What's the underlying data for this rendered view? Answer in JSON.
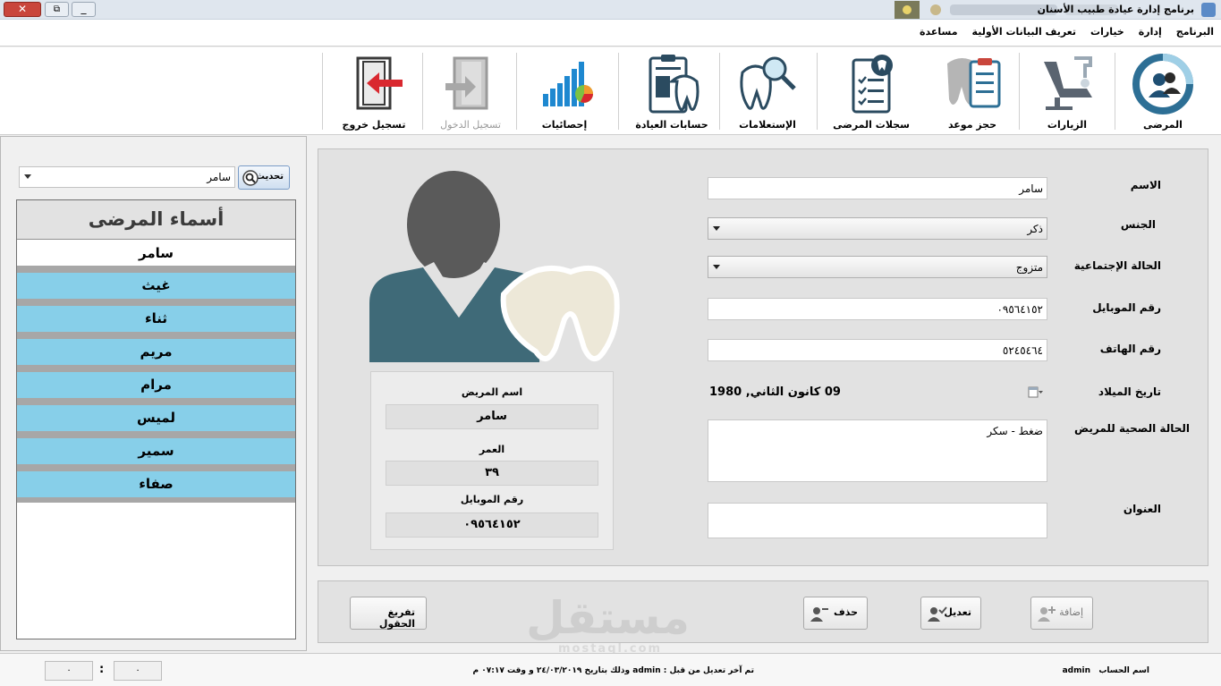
{
  "window": {
    "title": "برنامج إدارة عيادة طبيب الأسنان",
    "close_glyph": "✕",
    "maximize_glyph": "⧉",
    "minimize_glyph": "_"
  },
  "menu": {
    "items": [
      "البرنامج",
      "إدارة",
      "خيارات",
      "تعريف البيانات الأولية",
      "مساعدة"
    ]
  },
  "toolbar": {
    "items": [
      {
        "label": "المرضى",
        "icon": "patients-icon"
      },
      {
        "label": "الزيارات",
        "icon": "dental-chair-icon"
      },
      {
        "label": "حجز موعد",
        "icon": "appointment-icon"
      },
      {
        "label": "سجلات المرضى",
        "icon": "patient-records-icon"
      },
      {
        "label": "الإستعلامات",
        "icon": "tooth-search-icon"
      },
      {
        "label": "حسابات العيادة",
        "icon": "clinic-accounts-icon"
      },
      {
        "label": "إحصائيات",
        "icon": "statistics-icon"
      },
      {
        "label": "تسجيل الدخول",
        "icon": "login-icon",
        "disabled": true
      },
      {
        "label": "تسجيل خروج",
        "icon": "logout-icon"
      }
    ]
  },
  "patients_panel": {
    "search_value": "سامر",
    "refresh_label": "تحديث",
    "list_title": "أسماء المرضى",
    "patients": [
      "سامر",
      "غيث",
      "ثناء",
      "مريم",
      "مرام",
      "لميس",
      "سمير",
      "صفاء"
    ]
  },
  "form": {
    "name_label": "الاسم",
    "name_value": "سامر",
    "gender_label": "الجنس",
    "gender_value": "ذكر",
    "marital_label": "الحالة الإجتماعية",
    "marital_value": "متزوج",
    "mobile_label": "رقم الموبايل",
    "mobile_value": "٠٩٥٦٤١٥٢",
    "phone_label": "رقم الهاتف",
    "phone_value": "٥٢٤٥٤٦٤",
    "birthdate_label": "تاريخ الميلاد",
    "birthdate_value": "09 كانون الثاني, 1980",
    "health_label": "الحالة الصحية للمريض",
    "health_value": "ضغط - سكر",
    "address_label": "العنوان",
    "address_value": ""
  },
  "summary": {
    "patient_name_label": "اسم المريض",
    "patient_name_value": "سامر",
    "age_label": "العمر",
    "age_value": "٣٩",
    "mobile_label": "رقم الموبايل",
    "mobile_value": "٠٩٥٦٤١٥٢"
  },
  "actions": {
    "add_label": "إضافة",
    "edit_label": "تعديل",
    "delete_label": "حذف",
    "clear_label": "تفريغ الحقول"
  },
  "status": {
    "account_label": "اسم الحساب",
    "account_value": "admin",
    "last_edit_text": "تم آخر تعديل من قبل  :  admin  وذلك بتاريخ  ٢٤/٠٣/٢٠١٩  و وقت ٠٧:١٧ م",
    "box_left": "٠",
    "colon": ":",
    "box_right": "٠"
  },
  "watermark": {
    "arabic": "مستقل",
    "latin": "mostaql.com"
  },
  "colors": {
    "list_item_bg": "#87cfe9",
    "separator": "#a7a7a7",
    "avatar_body": "#3f6a78",
    "avatar_head": "#5a5a5a",
    "logout_red": "#d9282f"
  }
}
